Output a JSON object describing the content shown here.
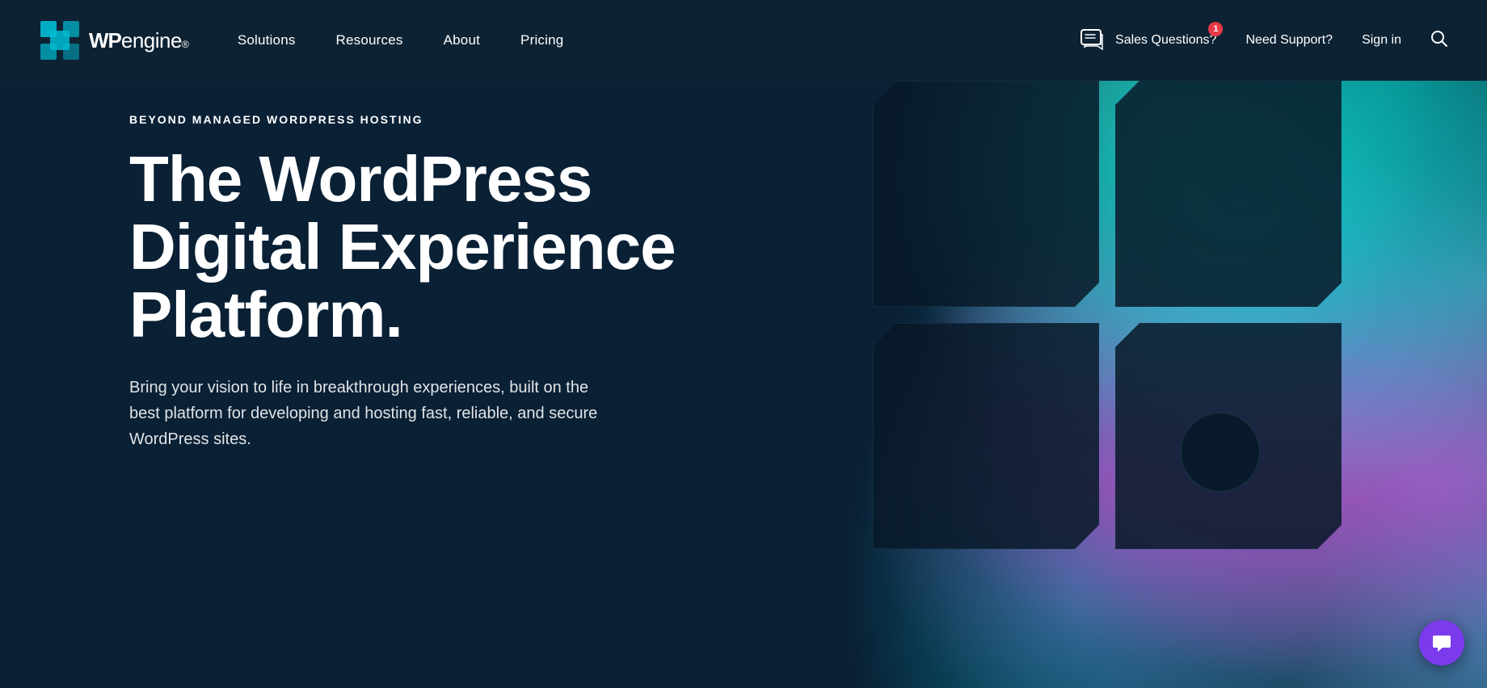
{
  "logo": {
    "wp": "WP",
    "engine": "engine",
    "reg": "®"
  },
  "nav": {
    "links": [
      {
        "label": "Solutions",
        "id": "solutions"
      },
      {
        "label": "Resources",
        "id": "resources"
      },
      {
        "label": "About",
        "id": "about"
      },
      {
        "label": "Pricing",
        "id": "pricing"
      }
    ],
    "right": [
      {
        "label": "Sales Questions?",
        "id": "sales"
      },
      {
        "label": "Need Support?",
        "id": "support"
      },
      {
        "label": "Sign in",
        "id": "signin"
      }
    ],
    "badge_count": "1"
  },
  "hero": {
    "eyebrow": "BEYOND MANAGED WORDPRESS HOSTING",
    "title": "The WordPress Digital Experience Platform.",
    "description": "Bring your vision to life in breakthrough experiences, built on the best platform for developing and hosting fast, reliable, and secure WordPress sites."
  },
  "colors": {
    "bg": "#0a2035",
    "nav_bg": "#0d2233",
    "accent": "#00bcd4",
    "badge": "#e63946",
    "chat_purple": "#7c3aed"
  }
}
